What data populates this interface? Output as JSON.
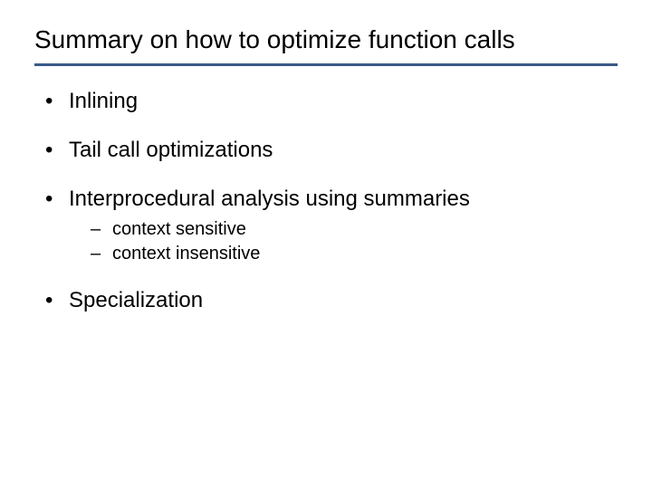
{
  "title": "Summary on how to optimize function calls",
  "bullets": {
    "b0": "Inlining",
    "b1": "Tail call optimizations",
    "b2": "Interprocedural analysis using summaries",
    "b2_sub": {
      "s0": "context sensitive",
      "s1": "context insensitive"
    },
    "b3": "Specialization"
  }
}
